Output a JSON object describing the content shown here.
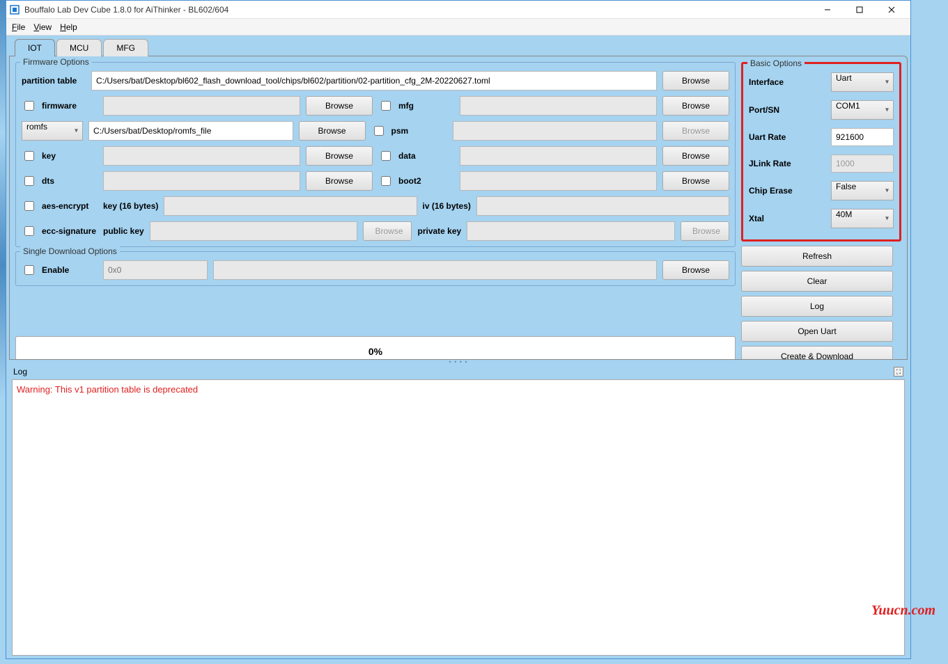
{
  "window": {
    "title": "Bouffalo Lab Dev Cube 1.8.0 for AiThinker - BL602/604"
  },
  "menu": {
    "file": "File",
    "view": "View",
    "help": "Help"
  },
  "tabs": {
    "iot": "IOT",
    "mcu": "MCU",
    "mfg": "MFG"
  },
  "firmware": {
    "group_title": "Firmware Options",
    "partition_label": "partition table",
    "partition_value": "C:/Users/bat/Desktop/bl602_flash_download_tool/chips/bl602/partition/02-partition_cfg_2M-20220627.toml",
    "firmware_label": "firmware",
    "mfg_label": "mfg",
    "romfs_label": "romfs",
    "romfs_value": "C:/Users/bat/Desktop/romfs_file",
    "psm_label": "psm",
    "key_label": "key",
    "data_label": "data",
    "dts_label": "dts",
    "boot2_label": "boot2",
    "aes_label": "aes-encrypt",
    "aes_key_label": "key (16 bytes)",
    "aes_iv_label": "iv (16 bytes)",
    "ecc_label": "ecc-signature",
    "ecc_pub_label": "public key",
    "ecc_priv_label": "private key",
    "browse": "Browse"
  },
  "download": {
    "group_title": "Single Download Options",
    "enable_label": "Enable",
    "addr_placeholder": "0x0",
    "browse": "Browse"
  },
  "basic": {
    "group_title": "Basic Options",
    "interface_label": "Interface",
    "interface_value": "Uart",
    "port_label": "Port/SN",
    "port_value": "COM1",
    "uart_rate_label": "Uart Rate",
    "uart_rate_value": "921600",
    "jlink_rate_label": "JLink Rate",
    "jlink_rate_value": "1000",
    "chip_erase_label": "Chip Erase",
    "chip_erase_value": "False",
    "xtal_label": "Xtal",
    "xtal_value": "40M"
  },
  "buttons": {
    "refresh": "Refresh",
    "clear": "Clear",
    "log": "Log",
    "open_uart": "Open Uart",
    "create_download": "Create & Download"
  },
  "progress": {
    "text": "0%"
  },
  "log": {
    "label": "Log",
    "content": "Warning: This v1 partition table is deprecated"
  },
  "watermark": "Yuucn.com"
}
